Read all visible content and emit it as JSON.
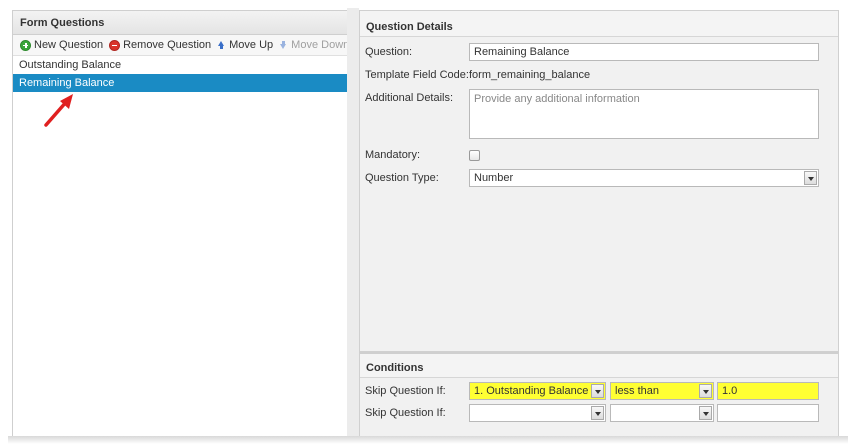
{
  "left_panel": {
    "title": "Form Questions",
    "toolbar": {
      "new_question": "New Question",
      "remove_question": "Remove Question",
      "move_up": "Move Up",
      "move_down": "Move Down"
    },
    "questions": [
      "Outstanding Balance",
      "Remaining Balance"
    ],
    "selected_index": 1
  },
  "details": {
    "title": "Question Details",
    "question_label": "Question:",
    "question_value": "Remaining Balance",
    "template_code_label": "Template Field Code:",
    "template_code_value": "form_remaining_balance",
    "additional_label": "Additional Details:",
    "additional_placeholder": "Provide any additional information",
    "mandatory_label": "Mandatory:",
    "mandatory_checked": false,
    "type_label": "Question Type:",
    "type_value": "Number"
  },
  "conditions": {
    "title": "Conditions",
    "rows": [
      {
        "label": "Skip Question If:",
        "question": "1. Outstanding Balance",
        "operator": "less than",
        "value": "1.0",
        "highlight": true
      },
      {
        "label": "Skip Question If:",
        "question": "",
        "operator": "",
        "value": "",
        "highlight": false
      }
    ]
  },
  "colors": {
    "selected_row": "#1a8bc4",
    "highlight": "#ffff33",
    "annotation_arrow": "#e02020"
  }
}
